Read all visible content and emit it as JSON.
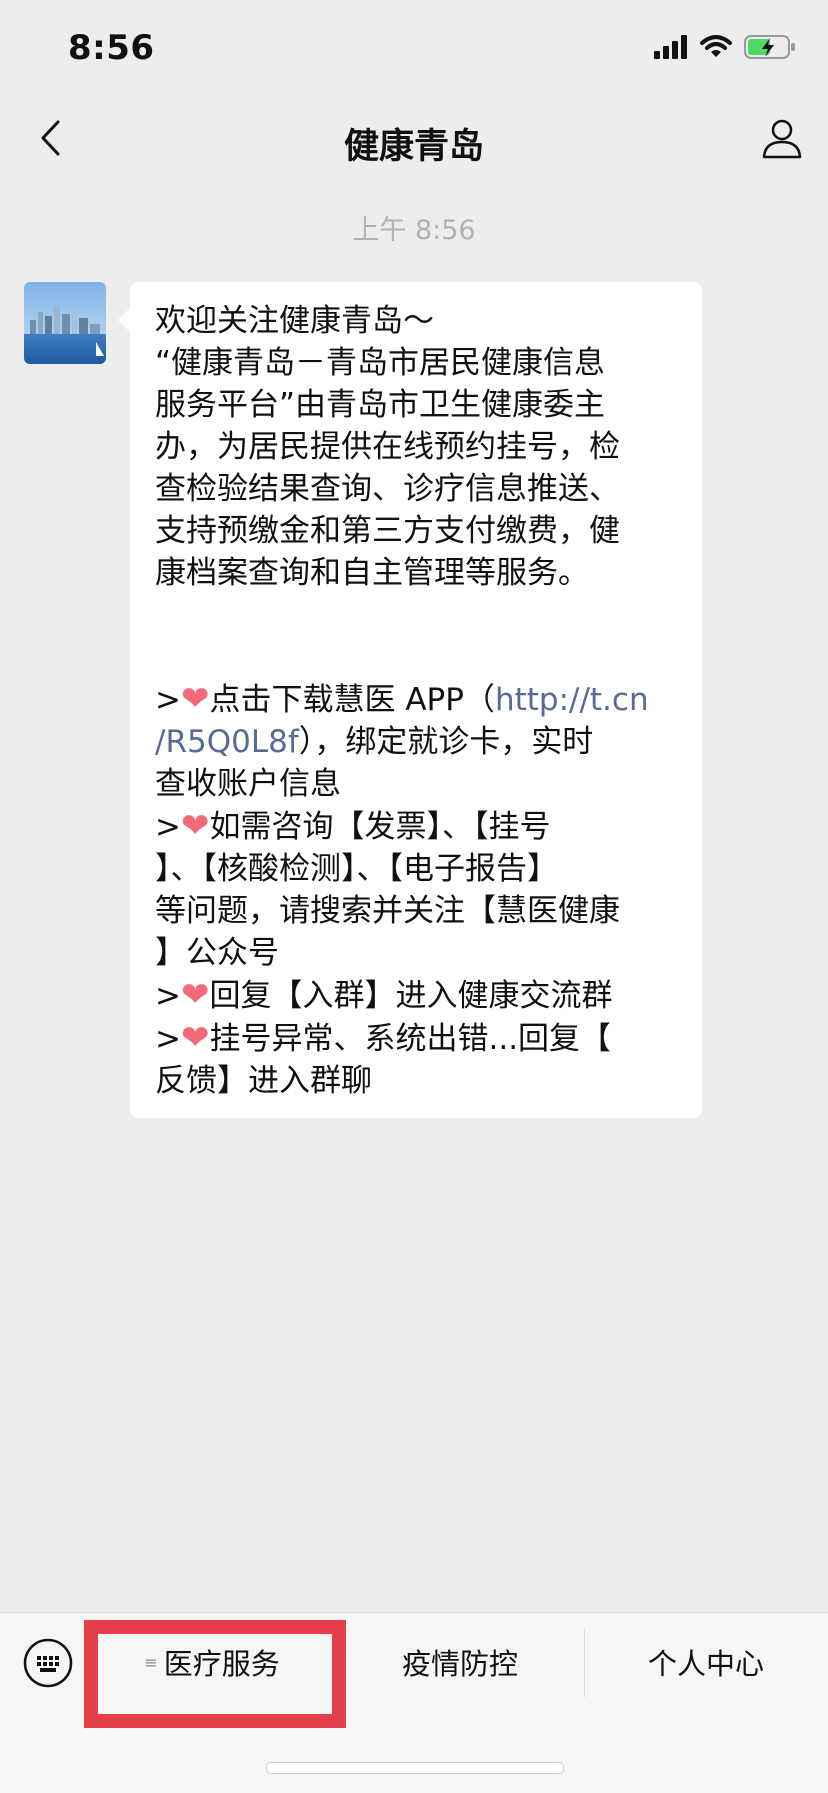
{
  "status": {
    "time": "8:56"
  },
  "nav": {
    "title": "健康青岛"
  },
  "chat": {
    "timestamp": "上午 8:56",
    "message": {
      "lines": [
        "欢迎关注健康青岛～",
        "“健康青岛－青岛市居民健康信息",
        "服务平台”由青岛市卫生健康委主",
        "办，为居民提供在线预约挂号，检",
        "查检验结果查询、诊疗信息推送、",
        "支持预缴金和第三方支付缴费，健",
        "康档案查询和自主管理等服务。"
      ],
      "heart": "❤",
      "prefix": ">",
      "item1_text": "点击下载慧医 APP（",
      "item1_link_a": "http://t.cn",
      "item1_link_b": "/R5Q0L8f",
      "item1_after": "），绑定就诊卡，实时",
      "item1_cont": "查收账户信息",
      "item2_text": "如需咨询【发票】、【挂号",
      "item2_cont1": "】、【核酸检测】、【电子报告】",
      "item2_cont2": "等问题，请搜索并关注【慧医健康",
      "item2_cont3": "】公众号",
      "item3_text": "回复【入群】进入健康交流群",
      "item4_text": "挂号异常、系统出错...回复【",
      "item4_cont": "反馈】进入群聊"
    }
  },
  "menu": {
    "items": [
      {
        "label": "医疗服务"
      },
      {
        "label": "疫情防控"
      },
      {
        "label": "个人中心"
      }
    ],
    "submenu_glyph": "≡"
  },
  "colors": {
    "link": "#576b95",
    "highlight": "#e5404a",
    "heart": "#f06a7a"
  }
}
